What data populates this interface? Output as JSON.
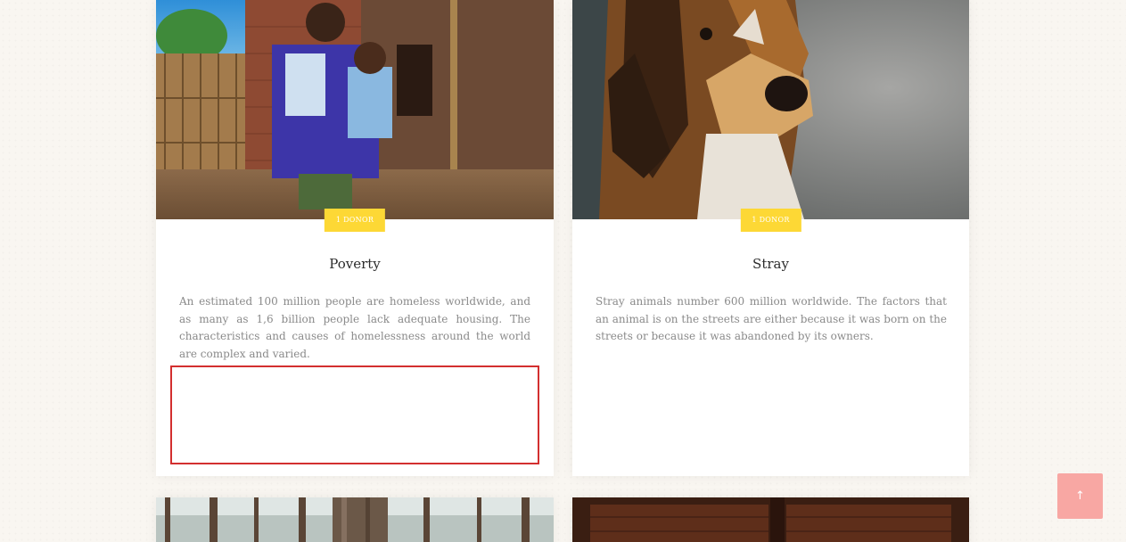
{
  "cards": [
    {
      "badge": "1 DONOR",
      "title": "Poverty",
      "description": "An estimated 100 million people are homeless worldwide, and as many as 1,6 billion people lack adequate housing. The characteristics and causes of homelessness around the world are complex and varied."
    },
    {
      "badge": "1 DONOR",
      "title": "Stray",
      "description": "Stray animals number 600 million worldwide. The factors that an animal is on the streets are either because it was born on the streets or because it was abandoned by its owners."
    }
  ],
  "scroll_top": {
    "icon": "arrow-up-icon",
    "glyph": "↑",
    "color": "#f8a7a3"
  },
  "colors": {
    "badge": "#fdd835",
    "highlight": "#d32f2f",
    "background": "#f9f6f1"
  }
}
